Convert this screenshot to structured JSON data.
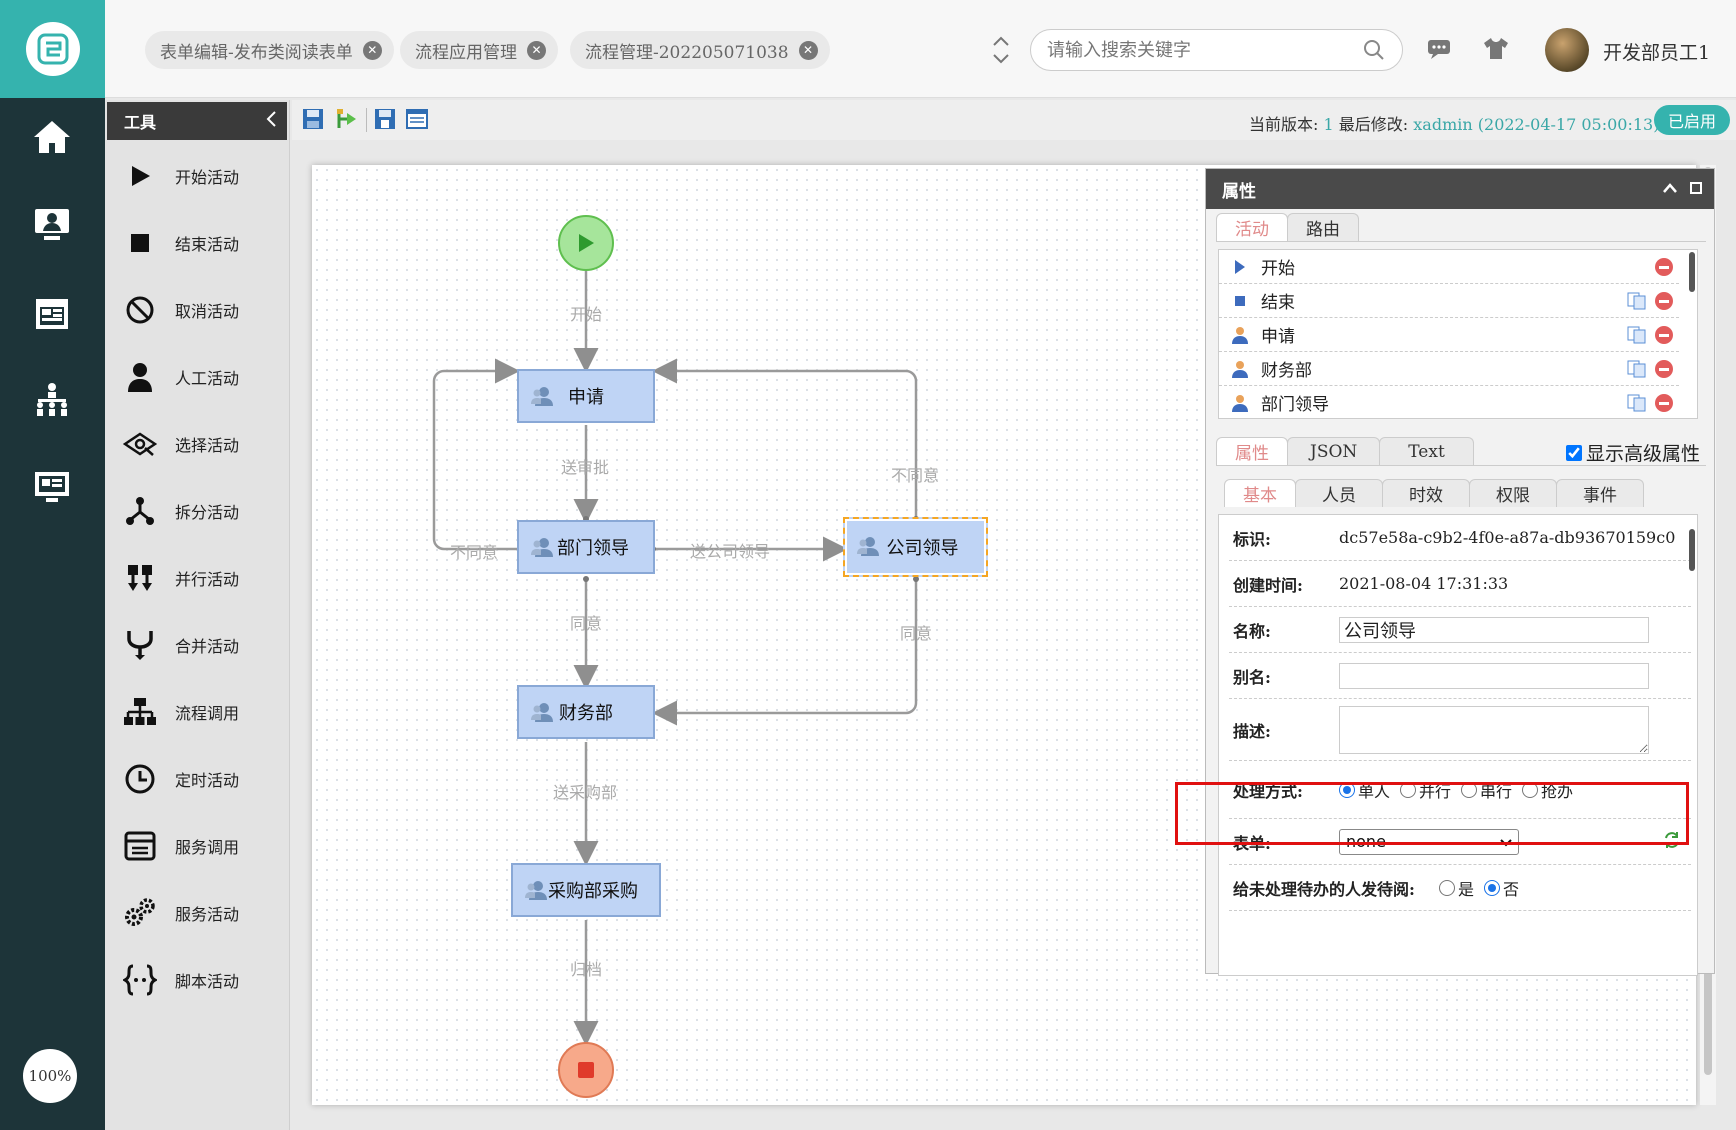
{
  "nav": {
    "zoom": "100%",
    "items": [
      "home-icon",
      "monitor-user-icon",
      "calendar-icon",
      "org-chart-icon",
      "screen-icon"
    ]
  },
  "header": {
    "tabs": [
      {
        "label": "表单编辑-发布类阅读表单"
      },
      {
        "label": "流程应用管理"
      },
      {
        "label": "流程管理-202205071038"
      }
    ],
    "search_placeholder": "请输入搜索关键字",
    "user": "开发部员工1"
  },
  "tools": {
    "title": "工具",
    "items": [
      {
        "label": "开始活动",
        "icon": "play-icon"
      },
      {
        "label": "结束活动",
        "icon": "stop-icon"
      },
      {
        "label": "取消活动",
        "icon": "ban-icon"
      },
      {
        "label": "人工活动",
        "icon": "user-icon"
      },
      {
        "label": "选择活动",
        "icon": "choice-icon"
      },
      {
        "label": "拆分活动",
        "icon": "split-icon"
      },
      {
        "label": "并行活动",
        "icon": "parallel-icon"
      },
      {
        "label": "合并活动",
        "icon": "merge-icon"
      },
      {
        "label": "流程调用",
        "icon": "process-call-icon"
      },
      {
        "label": "定时活动",
        "icon": "clock-icon"
      },
      {
        "label": "服务调用",
        "icon": "service-call-icon"
      },
      {
        "label": "服务活动",
        "icon": "gears-icon"
      },
      {
        "label": "脚本活动",
        "icon": "script-icon"
      }
    ]
  },
  "toolbar": {
    "version_label": "当前版本:",
    "version": "1",
    "modified_label": "最后修改:",
    "modified_by": "xadmin (2022-04-17 05:00:13)",
    "status": "已启用"
  },
  "flow": {
    "nodes": {
      "apply": "申请",
      "dept_leader": "部门领导",
      "company_leader": "公司领导",
      "finance": "财务部",
      "purchase": "采购部采购"
    },
    "edges": {
      "start": "开始",
      "submit": "送审批",
      "disagree_left": "不同意",
      "to_company": "送公司领导",
      "disagree_right": "不同意",
      "agree_left": "同意",
      "agree_right": "同意",
      "to_purchase": "送采购部",
      "archive": "归档"
    }
  },
  "props": {
    "title": "属性",
    "top_tabs": [
      "活动",
      "路由"
    ],
    "activities": [
      {
        "name": "开始",
        "icon": "play-icon"
      },
      {
        "name": "结束",
        "icon": "stop-icon"
      },
      {
        "name": "申请",
        "icon": "user-icon"
      },
      {
        "name": "财务部",
        "icon": "user-icon"
      },
      {
        "name": "部门领导",
        "icon": "user-icon"
      }
    ],
    "view_tabs": [
      "属性",
      "JSON",
      "Text"
    ],
    "advanced_label": "显示高级属性",
    "detail_tabs": [
      "基本",
      "人员",
      "时效",
      "权限",
      "事件"
    ],
    "fields": {
      "id_label": "标识:",
      "id_value": "dc57e58a-c9b2-4f0e-a87a-db93670159c0",
      "created_label": "创建时间:",
      "created_value": "2021-08-04 17:31:33",
      "name_label": "名称:",
      "name_value": "公司领导",
      "alias_label": "别名:",
      "alias_value": "",
      "desc_label": "描述:",
      "mode_label": "处理方式:",
      "mode_options": [
        "单人",
        "并行",
        "串行",
        "抢办"
      ],
      "mode_selected": "单人",
      "form_label": "表单:",
      "form_value": "none",
      "notify_label": "给未处理待办的人发待阅:",
      "notify_options": [
        "是",
        "否"
      ],
      "notify_selected": "否"
    }
  }
}
